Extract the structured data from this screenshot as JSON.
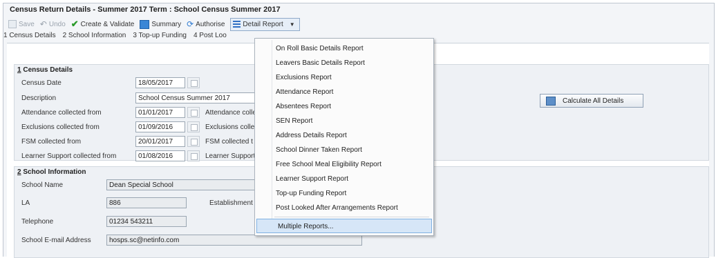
{
  "window": {
    "title": "Census Return Details - Summer 2017 Term : School Census Summer 2017"
  },
  "toolbar": {
    "save": "Save",
    "undo": "Undo",
    "create_validate": "Create & Validate",
    "summary": "Summary",
    "authorise": "Authorise",
    "detail_report": "Detail Report"
  },
  "tabs": [
    "1 Census Details",
    "2 School Information",
    "3 Top-up Funding",
    "4 Post Loo"
  ],
  "census_details": {
    "title_num": "1",
    "title": " Census Details",
    "census_date_label": "Census Date",
    "census_date": "18/05/2017",
    "description_label": "Description",
    "description": "School Census Summer 2017",
    "attendance_from_label": "Attendance collected from",
    "attendance_from": "01/01/2017",
    "attendance_to_label": "Attendance colle",
    "exclusions_from_label": "Exclusions collected from",
    "exclusions_from": "01/09/2016",
    "exclusions_to_label": "Exclusions colle",
    "fsm_from_label": "FSM collected from",
    "fsm_from": "20/01/2017",
    "fsm_to_label": "FSM collected t",
    "learner_from_label": "Learner Support collected from",
    "learner_from": "01/08/2016",
    "learner_to_label": "Learner Support"
  },
  "calculate_all": "Calculate All Details",
  "school_information": {
    "title_num": "2",
    "title": " School Information",
    "school_name_label": "School Name",
    "school_name": "Dean Special School",
    "la_label": "LA",
    "la": "886",
    "establishment_label": "Establishment N",
    "telephone_label": "Telephone",
    "telephone": "01234 543211",
    "email_label": "School E-mail Address",
    "email": "hosps.sc@netinfo.com"
  },
  "detail_report_menu": [
    "On Roll Basic Details Report",
    "Leavers Basic Details Report",
    "Exclusions Report",
    "Attendance Report",
    "Absentees Report",
    "SEN Report",
    "Address Details Report",
    "School Dinner Taken Report",
    "Free School Meal Eligibility Report",
    "Learner Support Report",
    "Top-up Funding Report",
    "Post Looked After Arrangements Report",
    "Multiple Reports..."
  ]
}
